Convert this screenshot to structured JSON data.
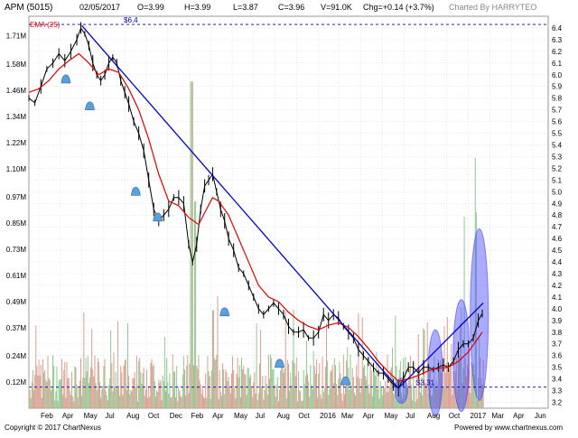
{
  "header": {
    "symbol": "APM (5015)",
    "date": "02/05/2017",
    "open": "O=3.99",
    "high": "H=3.99",
    "low": "L=3.87",
    "close": "C=3.96",
    "volume": "V=91.0K",
    "change": "Chg=+0.14 (+3.7%)",
    "charted_by": "Charted By HARRYTEO"
  },
  "indicator_label": "EMA (25)",
  "footer": {
    "copyright": "Copyright © 2017 ChartNexus",
    "powered_by": "Powered by www.chartnexus.com"
  },
  "colors": {
    "price": "#000000",
    "ema": "#e00000",
    "trendline": "#0000cc",
    "volume_down": "#d8a090",
    "volume_up": "#90c890",
    "ellipse": "#4444ff",
    "arrow": "#5aa0e0",
    "grid": "#cccccc",
    "dashed": "#0000aa"
  },
  "chart_data": {
    "type": "line",
    "title": "APM (5015)",
    "x_tick_labels": [
      "Feb",
      "Apr",
      "May",
      "Jul",
      "Aug",
      "Oct",
      "Dec",
      "Feb",
      "Apr",
      "May",
      "Jul",
      "Aug",
      "Oct",
      "2016",
      "Mar",
      "Apr",
      "May",
      "Jul",
      "Aug",
      "Oct",
      "2017",
      "Mar",
      "Apr",
      "Jun"
    ],
    "y_price_ticks": [
      "3.2",
      "3.3",
      "3.4",
      "3.5",
      "3.6",
      "3.7",
      "3.8",
      "3.9",
      "4.0",
      "4.1",
      "4.2",
      "4.3",
      "4.4",
      "4.5",
      "4.6",
      "4.7",
      "4.8",
      "4.9",
      "5.0",
      "5.1",
      "5.2",
      "5.3",
      "5.4",
      "5.5",
      "5.6",
      "5.7",
      "5.8",
      "5.9",
      "6.0",
      "6.1",
      "6.2",
      "6.3",
      "6.4"
    ],
    "y_volume_ticks": [
      "0.12M",
      "0.24M",
      "0.37M",
      "0.49M",
      "0.61M",
      "0.73M",
      "0.85M",
      "0.97M",
      "1.10M",
      "1.22M",
      "1.34M",
      "1.46M",
      "1.58M",
      "1.71M"
    ],
    "ylim_price": [
      3.15,
      6.5
    ],
    "ylim_volume": [
      0,
      1.8
    ],
    "annotations": [
      {
        "text": "$6.4",
        "value": 6.43
      },
      {
        "text": "$3.31",
        "value": 3.33
      }
    ],
    "series": [
      {
        "role": "price",
        "points": [
          [
            0.0,
            5.8
          ],
          [
            0.6,
            5.76
          ],
          [
            1.2,
            5.9
          ],
          [
            1.8,
            6.05
          ],
          [
            2.4,
            6.1
          ],
          [
            3.0,
            6.18
          ],
          [
            3.6,
            6.12
          ],
          [
            4.2,
            6.2
          ],
          [
            4.8,
            6.3
          ],
          [
            5.2,
            6.4
          ],
          [
            5.6,
            6.35
          ],
          [
            6.0,
            6.25
          ],
          [
            6.4,
            6.1
          ],
          [
            6.8,
            6.0
          ],
          [
            7.2,
            5.95
          ],
          [
            7.6,
            6.0
          ],
          [
            8.0,
            6.1
          ],
          [
            8.4,
            6.15
          ],
          [
            8.8,
            6.1
          ],
          [
            9.2,
            5.95
          ],
          [
            9.6,
            5.85
          ],
          [
            10.0,
            5.75
          ],
          [
            10.5,
            5.6
          ],
          [
            11.0,
            5.5
          ],
          [
            11.5,
            5.35
          ],
          [
            12.0,
            5.1
          ],
          [
            12.5,
            4.85
          ],
          [
            13.0,
            4.75
          ],
          [
            13.5,
            4.8
          ],
          [
            14.0,
            4.85
          ],
          [
            14.5,
            4.95
          ],
          [
            15.0,
            4.95
          ],
          [
            15.5,
            4.9
          ],
          [
            16.0,
            4.55
          ],
          [
            16.4,
            4.4
          ],
          [
            16.8,
            4.55
          ],
          [
            17.2,
            4.85
          ],
          [
            17.6,
            5.05
          ],
          [
            18.0,
            5.1
          ],
          [
            18.4,
            5.15
          ],
          [
            18.8,
            5.0
          ],
          [
            19.2,
            4.85
          ],
          [
            19.6,
            4.75
          ],
          [
            20.0,
            4.6
          ],
          [
            20.5,
            4.5
          ],
          [
            21.0,
            4.35
          ],
          [
            21.5,
            4.3
          ],
          [
            22.0,
            4.2
          ],
          [
            22.5,
            4.1
          ],
          [
            23.0,
            4.0
          ],
          [
            23.5,
            3.95
          ],
          [
            24.0,
            4.0
          ],
          [
            24.5,
            4.05
          ],
          [
            25.0,
            4.0
          ],
          [
            25.5,
            3.95
          ],
          [
            26.0,
            3.85
          ],
          [
            26.5,
            3.8
          ],
          [
            27.0,
            3.8
          ],
          [
            27.5,
            3.82
          ],
          [
            28.0,
            3.75
          ],
          [
            28.5,
            3.75
          ],
          [
            29.0,
            3.8
          ],
          [
            29.5,
            3.95
          ],
          [
            30.0,
            3.9
          ],
          [
            30.5,
            3.95
          ],
          [
            31.0,
            3.92
          ],
          [
            31.5,
            3.85
          ],
          [
            32.0,
            3.8
          ],
          [
            32.5,
            3.75
          ],
          [
            33.0,
            3.65
          ],
          [
            33.5,
            3.6
          ],
          [
            34.0,
            3.55
          ],
          [
            34.5,
            3.5
          ],
          [
            35.0,
            3.45
          ],
          [
            35.5,
            3.45
          ],
          [
            36.0,
            3.4
          ],
          [
            36.5,
            3.35
          ],
          [
            37.0,
            3.32
          ],
          [
            37.5,
            3.4
          ],
          [
            38.0,
            3.5
          ],
          [
            38.5,
            3.5
          ],
          [
            39.0,
            3.45
          ],
          [
            39.5,
            3.5
          ],
          [
            40.0,
            3.5
          ],
          [
            40.5,
            3.48
          ],
          [
            41.0,
            3.5
          ],
          [
            41.5,
            3.52
          ],
          [
            42.0,
            3.5
          ],
          [
            42.5,
            3.55
          ],
          [
            43.0,
            3.65
          ],
          [
            43.5,
            3.7
          ],
          [
            44.0,
            3.7
          ],
          [
            44.5,
            3.75
          ],
          [
            45.0,
            3.9
          ],
          [
            45.4,
            3.96
          ]
        ]
      },
      {
        "role": "EMA (25)",
        "points": [
          [
            0.0,
            5.85
          ],
          [
            1.0,
            5.88
          ],
          [
            2.0,
            5.95
          ],
          [
            3.0,
            6.05
          ],
          [
            4.0,
            6.12
          ],
          [
            5.0,
            6.18
          ],
          [
            6.0,
            6.1
          ],
          [
            7.0,
            6.0
          ],
          [
            8.0,
            6.05
          ],
          [
            9.0,
            6.02
          ],
          [
            10.0,
            5.88
          ],
          [
            11.0,
            5.7
          ],
          [
            12.0,
            5.45
          ],
          [
            13.0,
            5.15
          ],
          [
            14.0,
            4.92
          ],
          [
            15.0,
            4.88
          ],
          [
            16.0,
            4.78
          ],
          [
            17.0,
            4.72
          ],
          [
            17.6,
            4.82
          ],
          [
            18.4,
            4.95
          ],
          [
            19.0,
            4.92
          ],
          [
            20.0,
            4.8
          ],
          [
            21.0,
            4.6
          ],
          [
            22.0,
            4.4
          ],
          [
            23.0,
            4.2
          ],
          [
            24.0,
            4.1
          ],
          [
            25.0,
            4.06
          ],
          [
            26.0,
            3.97
          ],
          [
            27.0,
            3.9
          ],
          [
            28.0,
            3.85
          ],
          [
            29.0,
            3.82
          ],
          [
            30.0,
            3.86
          ],
          [
            31.0,
            3.88
          ],
          [
            32.0,
            3.84
          ],
          [
            33.0,
            3.76
          ],
          [
            34.0,
            3.66
          ],
          [
            35.0,
            3.55
          ],
          [
            36.0,
            3.46
          ],
          [
            37.0,
            3.38
          ],
          [
            38.0,
            3.4
          ],
          [
            39.0,
            3.43
          ],
          [
            40.0,
            3.47
          ],
          [
            41.0,
            3.49
          ],
          [
            42.0,
            3.5
          ],
          [
            43.0,
            3.55
          ],
          [
            44.0,
            3.63
          ],
          [
            45.0,
            3.75
          ],
          [
            45.4,
            3.8
          ]
        ]
      }
    ],
    "trendlines": [
      {
        "from": [
          5.3,
          6.42
        ],
        "to": [
          37.0,
          3.32
        ]
      },
      {
        "from": [
          37.0,
          3.32
        ],
        "to": [
          45.5,
          4.05
        ]
      }
    ],
    "support_arrows_at_price": [
      5.96,
      5.73,
      5.0,
      4.78,
      3.97,
      3.53,
      3.38
    ]
  }
}
